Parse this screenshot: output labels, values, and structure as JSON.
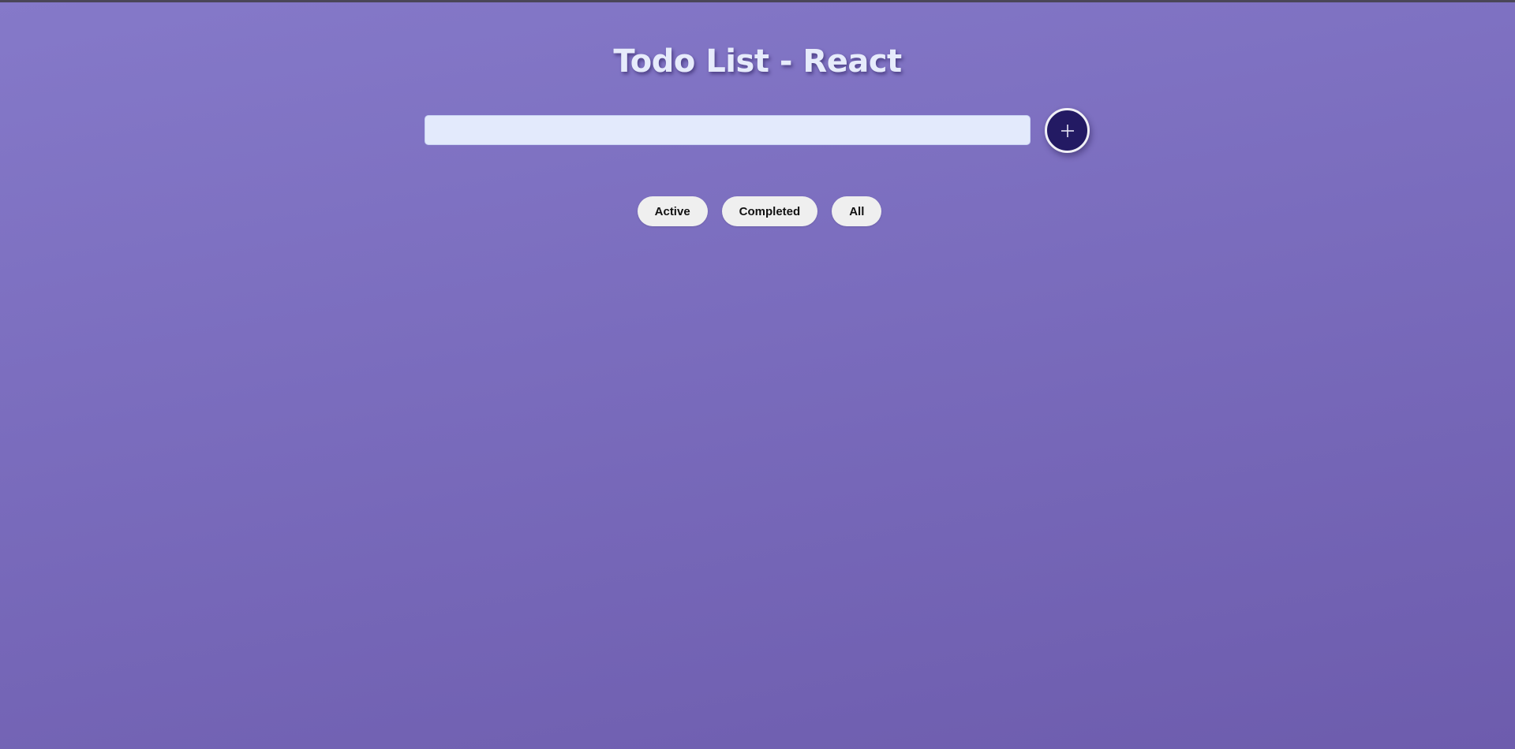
{
  "header": {
    "title": "Todo List - React"
  },
  "add_form": {
    "input_value": "",
    "input_placeholder": "",
    "add_icon": "plus-icon"
  },
  "filters": {
    "items": [
      {
        "label": "Active"
      },
      {
        "label": "Completed"
      },
      {
        "label": "All"
      }
    ]
  },
  "colors": {
    "background_top": "#8579c9",
    "background_bottom": "#6d5cad",
    "input_bg": "#e3eafc",
    "add_button_bg": "#231a63",
    "filter_button_bg": "#efefef"
  }
}
